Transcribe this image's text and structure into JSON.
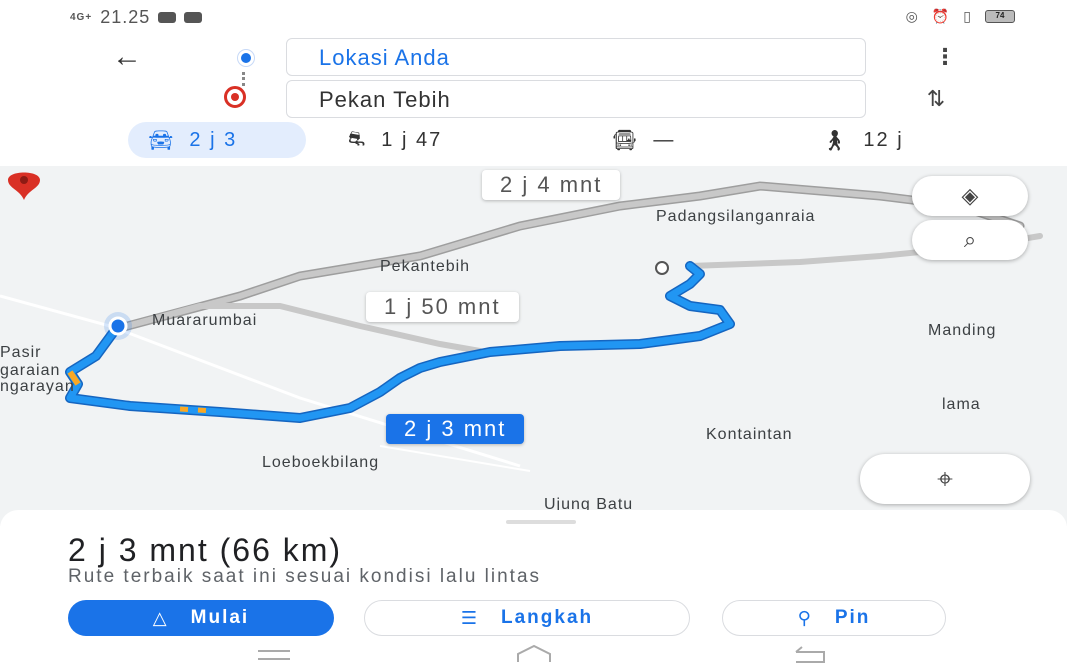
{
  "status_bar": {
    "network": "4G+",
    "time": "21.25",
    "battery": "74"
  },
  "directions": {
    "origin": "Lokasi Anda",
    "destination": "Pekan Tebih"
  },
  "modes": {
    "car": "2 j 3",
    "motorcycle": "1 j 47",
    "transit": "—",
    "walk": "12 j"
  },
  "map": {
    "places": {
      "padang": "Padangsilanganraia",
      "pekantebih": "Pekantebih",
      "muara": "Muararumbai",
      "manding": "Manding",
      "pasir": "Pasir",
      "pengaraian1": "garaian",
      "pengaraian2": "ngarayan",
      "lama": "lama",
      "kontaintan": "Kontaintan",
      "loeboek": "Loeboekbilang",
      "ujung": "Ujung Batu"
    },
    "route_labels": {
      "alt1": "2 j 4 mnt",
      "alt2": "1 j 50 mnt",
      "best": "2 j 3 mnt"
    }
  },
  "summary": {
    "title": "2 j 3 mnt (66 km)",
    "subtitle": "Rute terbaik saat ini sesuai kondisi lalu lintas"
  },
  "actions": {
    "start": "Mulai",
    "steps": "Langkah",
    "pin": "Pin"
  },
  "colors": {
    "accent": "#1a73e8",
    "destination_red": "#d93025",
    "route_blue": "#2196f3",
    "alt_route_gray": "#bdbdbd"
  },
  "icons": [
    "back-arrow-icon",
    "origin-dot-icon",
    "destination-pin-icon",
    "more-icon",
    "swap-icon",
    "car-icon",
    "motorcycle-icon",
    "transit-icon",
    "walk-icon",
    "layers-icon",
    "search-icon",
    "my-location-icon",
    "navigate-icon",
    "list-icon",
    "pin-icon"
  ]
}
